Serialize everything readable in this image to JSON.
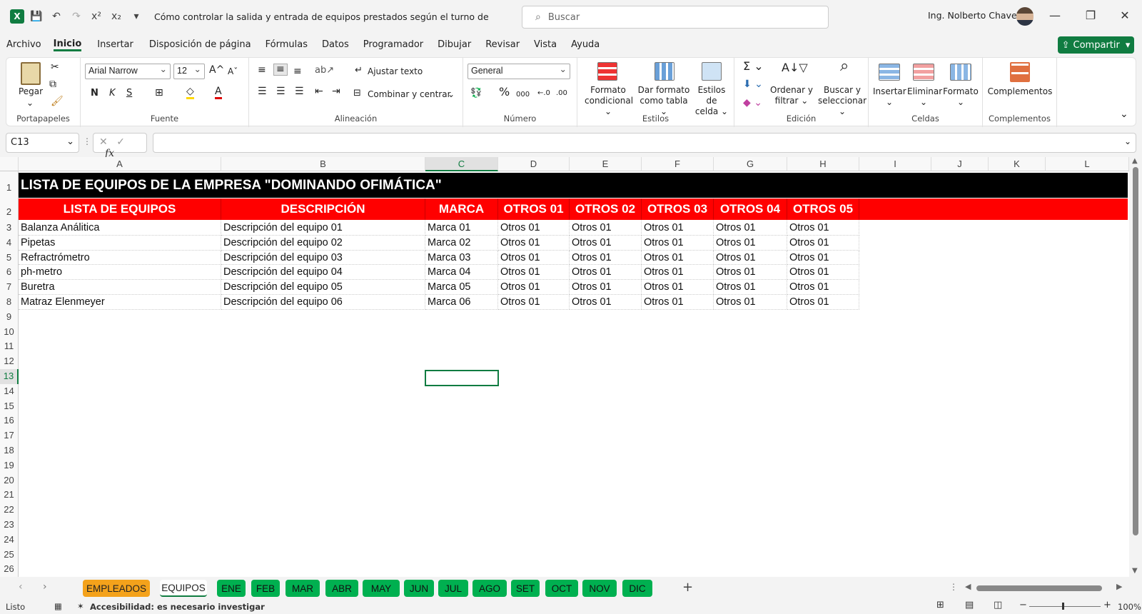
{
  "titlebar": {
    "title": "Cómo controlar la salida y entrada de equipos prestados según el turno de trabajo  -  E...",
    "search_placeholder": "Buscar",
    "user": "Ing. Nolberto Chavez"
  },
  "menu": [
    "Archivo",
    "Inicio",
    "Insertar",
    "Disposición de página",
    "Fórmulas",
    "Datos",
    "Programador",
    "Dibujar",
    "Revisar",
    "Vista",
    "Ayuda"
  ],
  "share_label": "Compartir",
  "ribbon": {
    "clipboard": {
      "paste": "Pegar",
      "label": "Portapapeles"
    },
    "font": {
      "name": "Arial Narrow",
      "size": "12",
      "bold": "N",
      "italic": "K",
      "underline": "S",
      "label": "Fuente"
    },
    "alignment": {
      "wrap": "Ajustar texto",
      "merge": "Combinar y centrar",
      "label": "Alineación"
    },
    "number": {
      "format": "General",
      "label": "Número"
    },
    "styles": {
      "cond_1": "Formato",
      "cond_2": "condicional",
      "table_1": "Dar formato",
      "table_2": "como tabla",
      "cell_1": "Estilos de",
      "cell_2": "celda",
      "label": "Estilos"
    },
    "editing": {
      "sort_1": "Ordenar y",
      "sort_2": "filtrar",
      "find_1": "Buscar y",
      "find_2": "seleccionar",
      "label": "Edición"
    },
    "cells": {
      "insert": "Insertar",
      "delete": "Eliminar",
      "format": "Formato",
      "label": "Celdas"
    },
    "addins": {
      "btn": "Complementos",
      "label": "Complementos"
    }
  },
  "formula_bar": {
    "cell_ref": "C13",
    "fx": "fx",
    "value": ""
  },
  "columns": [
    "A",
    "B",
    "C",
    "D",
    "E",
    "F",
    "G",
    "H",
    "I",
    "J",
    "K",
    "L"
  ],
  "rows": [
    "1",
    "2",
    "3",
    "4",
    "5",
    "6",
    "7",
    "8",
    "9",
    "10",
    "11",
    "12",
    "13",
    "14",
    "15",
    "16",
    "17",
    "18",
    "19",
    "20",
    "21",
    "22",
    "23",
    "24",
    "25",
    "26"
  ],
  "sheet": {
    "title": "LISTA DE EQUIPOS DE LA EMPRESA \"DOMINANDO OFIMÁTICA\"",
    "headers": [
      "LISTA DE EQUIPOS",
      "DESCRIPCIÓN",
      "MARCA",
      "OTROS 01",
      "OTROS 02",
      "OTROS 03",
      "OTROS 04",
      "OTROS 05"
    ],
    "data": [
      [
        "Balanza Análitica",
        "Descripción del equipo 01",
        "Marca 01",
        "Otros 01",
        "Otros 01",
        "Otros 01",
        "Otros 01",
        "Otros 01"
      ],
      [
        "Pipetas",
        "Descripción del equipo 02",
        "Marca 02",
        "Otros 01",
        "Otros 01",
        "Otros 01",
        "Otros 01",
        "Otros 01"
      ],
      [
        "Refractrómetro",
        "Descripción del equipo 03",
        "Marca 03",
        "Otros 01",
        "Otros 01",
        "Otros 01",
        "Otros 01",
        "Otros 01"
      ],
      [
        "ph-metro",
        "Descripción del equipo 04",
        "Marca 04",
        "Otros 01",
        "Otros 01",
        "Otros 01",
        "Otros 01",
        "Otros 01"
      ],
      [
        "Buretra",
        "Descripción del equipo 05",
        "Marca 05",
        "Otros 01",
        "Otros 01",
        "Otros 01",
        "Otros 01",
        "Otros 01"
      ],
      [
        "Matraz Elenmeyer",
        "Descripción del equipo 06",
        "Marca 06",
        "Otros 01",
        "Otros 01",
        "Otros 01",
        "Otros 01",
        "Otros 01"
      ]
    ]
  },
  "tabs": [
    {
      "label": "EMPLEADOS",
      "color": "#f4a21b"
    },
    {
      "label": "EQUIPOS",
      "color": "active"
    },
    {
      "label": "ENE",
      "color": "#00b050"
    },
    {
      "label": "FEB",
      "color": "#00b050"
    },
    {
      "label": "MAR",
      "color": "#00b050"
    },
    {
      "label": "ABR",
      "color": "#00b050"
    },
    {
      "label": "MAY",
      "color": "#00b050"
    },
    {
      "label": "JUN",
      "color": "#00b050"
    },
    {
      "label": "JUL",
      "color": "#00b050"
    },
    {
      "label": "AGO",
      "color": "#00b050"
    },
    {
      "label": "SET",
      "color": "#00b050"
    },
    {
      "label": "OCT",
      "color": "#00b050"
    },
    {
      "label": "NOV",
      "color": "#00b050"
    },
    {
      "label": "DIC",
      "color": "#00b050"
    }
  ],
  "status": {
    "ready": "Listo",
    "accessibility": "Accesibilidad: es necesario investigar",
    "zoom": "100%"
  }
}
